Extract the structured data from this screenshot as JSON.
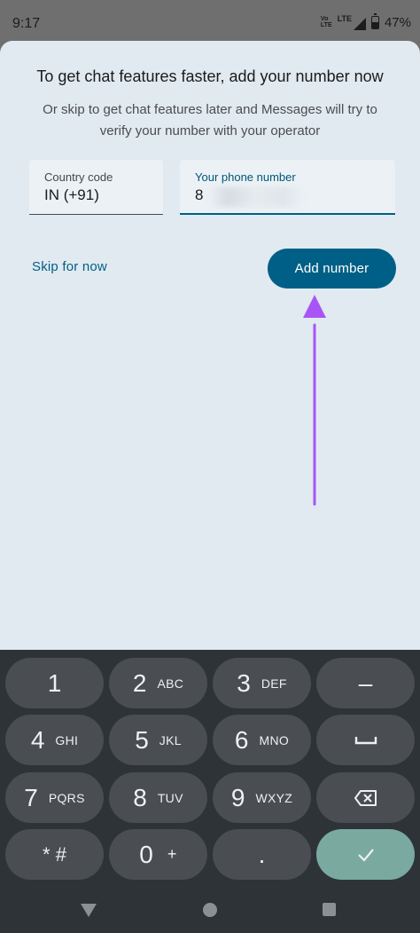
{
  "status_bar": {
    "time": "9:17",
    "volte_top": "Vo",
    "volte_mid": "LTE",
    "network": "LTE",
    "battery": "47%",
    "battery_level": 0.47
  },
  "sheet": {
    "title": "To get chat features faster, add your number now",
    "subtitle": "Or skip to get chat features later and Messages will try to verify your number with your operator"
  },
  "country_field": {
    "label": "Country code",
    "value": "IN (+91)"
  },
  "phone_field": {
    "label": "Your phone number",
    "value": "8"
  },
  "actions": {
    "skip_label": "Skip for now",
    "add_label": "Add number"
  },
  "keypad": {
    "keys": [
      {
        "digit": "1",
        "letters": ""
      },
      {
        "digit": "2",
        "letters": "ABC"
      },
      {
        "digit": "3",
        "letters": "DEF"
      },
      {
        "digit": "–",
        "letters": ""
      },
      {
        "digit": "4",
        "letters": "GHI"
      },
      {
        "digit": "5",
        "letters": "JKL"
      },
      {
        "digit": "6",
        "letters": "MNO"
      },
      {
        "digit": "",
        "letters": ""
      },
      {
        "digit": "7",
        "letters": "PQRS"
      },
      {
        "digit": "8",
        "letters": "TUV"
      },
      {
        "digit": "9",
        "letters": "WXYZ"
      },
      {
        "digit": "",
        "letters": ""
      },
      {
        "digit": "* #",
        "letters": ""
      },
      {
        "digit": "0",
        "letters": "+"
      },
      {
        "digit": ".",
        "letters": ""
      },
      {
        "digit": "",
        "letters": ""
      }
    ]
  },
  "colors": {
    "accent": "#005f86",
    "annotation_arrow": "#a855f7",
    "confirm_key": "#7aa9a0"
  }
}
